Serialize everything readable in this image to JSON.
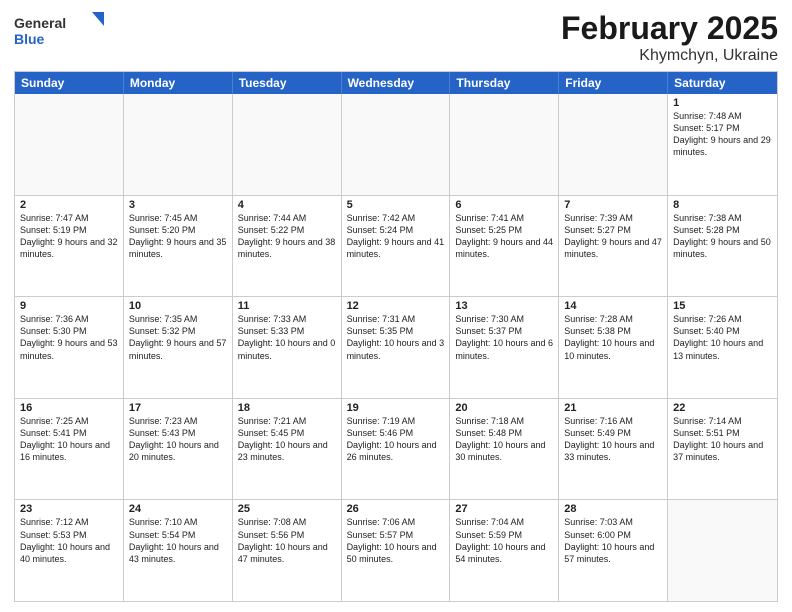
{
  "header": {
    "logo_general": "General",
    "logo_blue": "Blue",
    "month_year": "February 2025",
    "location": "Khymchyn, Ukraine"
  },
  "weekdays": [
    "Sunday",
    "Monday",
    "Tuesday",
    "Wednesday",
    "Thursday",
    "Friday",
    "Saturday"
  ],
  "rows": [
    [
      {
        "day": "",
        "empty": true
      },
      {
        "day": "",
        "empty": true
      },
      {
        "day": "",
        "empty": true
      },
      {
        "day": "",
        "empty": true
      },
      {
        "day": "",
        "empty": true
      },
      {
        "day": "",
        "empty": true
      },
      {
        "day": "1",
        "info": "Sunrise: 7:48 AM\nSunset: 5:17 PM\nDaylight: 9 hours\nand 29 minutes."
      }
    ],
    [
      {
        "day": "2",
        "info": "Sunrise: 7:47 AM\nSunset: 5:19 PM\nDaylight: 9 hours\nand 32 minutes."
      },
      {
        "day": "3",
        "info": "Sunrise: 7:45 AM\nSunset: 5:20 PM\nDaylight: 9 hours\nand 35 minutes."
      },
      {
        "day": "4",
        "info": "Sunrise: 7:44 AM\nSunset: 5:22 PM\nDaylight: 9 hours\nand 38 minutes."
      },
      {
        "day": "5",
        "info": "Sunrise: 7:42 AM\nSunset: 5:24 PM\nDaylight: 9 hours\nand 41 minutes."
      },
      {
        "day": "6",
        "info": "Sunrise: 7:41 AM\nSunset: 5:25 PM\nDaylight: 9 hours\nand 44 minutes."
      },
      {
        "day": "7",
        "info": "Sunrise: 7:39 AM\nSunset: 5:27 PM\nDaylight: 9 hours\nand 47 minutes."
      },
      {
        "day": "8",
        "info": "Sunrise: 7:38 AM\nSunset: 5:28 PM\nDaylight: 9 hours\nand 50 minutes."
      }
    ],
    [
      {
        "day": "9",
        "info": "Sunrise: 7:36 AM\nSunset: 5:30 PM\nDaylight: 9 hours\nand 53 minutes."
      },
      {
        "day": "10",
        "info": "Sunrise: 7:35 AM\nSunset: 5:32 PM\nDaylight: 9 hours\nand 57 minutes."
      },
      {
        "day": "11",
        "info": "Sunrise: 7:33 AM\nSunset: 5:33 PM\nDaylight: 10 hours\nand 0 minutes."
      },
      {
        "day": "12",
        "info": "Sunrise: 7:31 AM\nSunset: 5:35 PM\nDaylight: 10 hours\nand 3 minutes."
      },
      {
        "day": "13",
        "info": "Sunrise: 7:30 AM\nSunset: 5:37 PM\nDaylight: 10 hours\nand 6 minutes."
      },
      {
        "day": "14",
        "info": "Sunrise: 7:28 AM\nSunset: 5:38 PM\nDaylight: 10 hours\nand 10 minutes."
      },
      {
        "day": "15",
        "info": "Sunrise: 7:26 AM\nSunset: 5:40 PM\nDaylight: 10 hours\nand 13 minutes."
      }
    ],
    [
      {
        "day": "16",
        "info": "Sunrise: 7:25 AM\nSunset: 5:41 PM\nDaylight: 10 hours\nand 16 minutes."
      },
      {
        "day": "17",
        "info": "Sunrise: 7:23 AM\nSunset: 5:43 PM\nDaylight: 10 hours\nand 20 minutes."
      },
      {
        "day": "18",
        "info": "Sunrise: 7:21 AM\nSunset: 5:45 PM\nDaylight: 10 hours\nand 23 minutes."
      },
      {
        "day": "19",
        "info": "Sunrise: 7:19 AM\nSunset: 5:46 PM\nDaylight: 10 hours\nand 26 minutes."
      },
      {
        "day": "20",
        "info": "Sunrise: 7:18 AM\nSunset: 5:48 PM\nDaylight: 10 hours\nand 30 minutes."
      },
      {
        "day": "21",
        "info": "Sunrise: 7:16 AM\nSunset: 5:49 PM\nDaylight: 10 hours\nand 33 minutes."
      },
      {
        "day": "22",
        "info": "Sunrise: 7:14 AM\nSunset: 5:51 PM\nDaylight: 10 hours\nand 37 minutes."
      }
    ],
    [
      {
        "day": "23",
        "info": "Sunrise: 7:12 AM\nSunset: 5:53 PM\nDaylight: 10 hours\nand 40 minutes."
      },
      {
        "day": "24",
        "info": "Sunrise: 7:10 AM\nSunset: 5:54 PM\nDaylight: 10 hours\nand 43 minutes."
      },
      {
        "day": "25",
        "info": "Sunrise: 7:08 AM\nSunset: 5:56 PM\nDaylight: 10 hours\nand 47 minutes."
      },
      {
        "day": "26",
        "info": "Sunrise: 7:06 AM\nSunset: 5:57 PM\nDaylight: 10 hours\nand 50 minutes."
      },
      {
        "day": "27",
        "info": "Sunrise: 7:04 AM\nSunset: 5:59 PM\nDaylight: 10 hours\nand 54 minutes."
      },
      {
        "day": "28",
        "info": "Sunrise: 7:03 AM\nSunset: 6:00 PM\nDaylight: 10 hours\nand 57 minutes."
      },
      {
        "day": "",
        "empty": true
      }
    ]
  ]
}
